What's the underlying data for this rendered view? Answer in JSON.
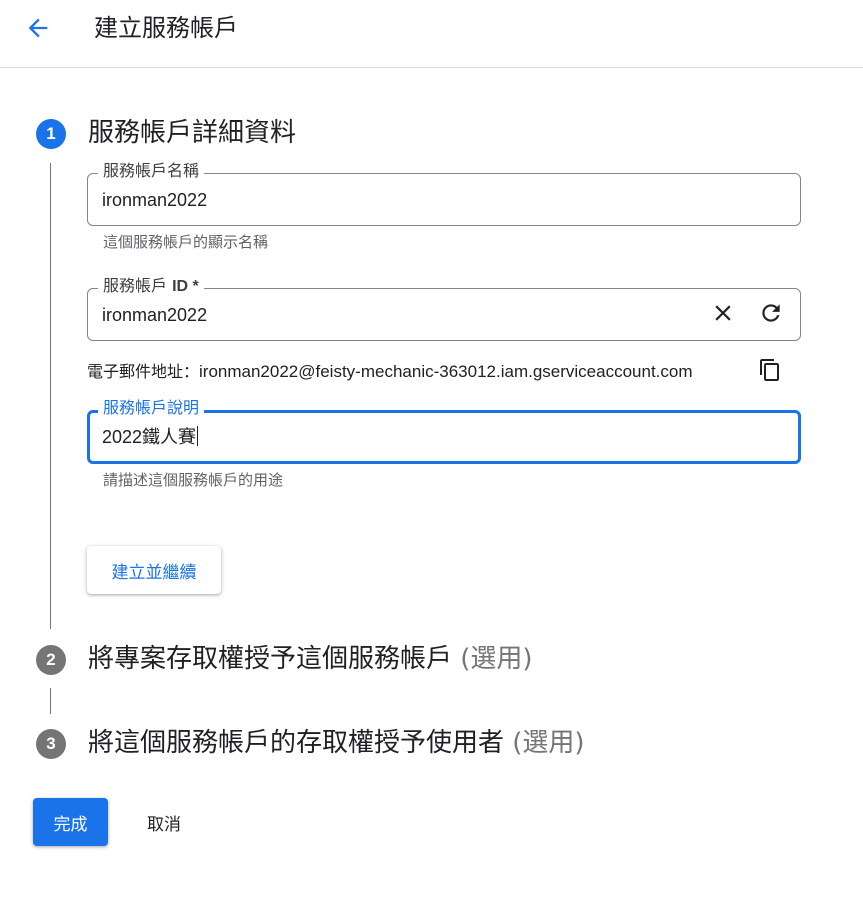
{
  "header": {
    "title": "建立服務帳戶",
    "back_icon": "arrow-back-icon"
  },
  "steps": [
    {
      "number": "1",
      "title": "服務帳戶詳細資料",
      "optional": ""
    },
    {
      "number": "2",
      "title": "將專案存取權授予這個服務帳戶",
      "optional": "(選用)"
    },
    {
      "number": "3",
      "title": "將這個服務帳戶的存取權授予使用者",
      "optional": "(選用)"
    }
  ],
  "form": {
    "name": {
      "label": "服務帳戶名稱",
      "value": "ironman2022",
      "helper": "這個服務帳戶的顯示名稱"
    },
    "id": {
      "label": "服務帳戶",
      "label_suffix": "ID *",
      "value": "ironman2022",
      "clear_icon": "close-icon",
      "refresh_icon": "refresh-icon"
    },
    "email": {
      "prefix": "電子郵件地址：",
      "address": "ironman2022@feisty-mechanic-363012.iam.gserviceaccount.com",
      "copy_icon": "copy-icon"
    },
    "description": {
      "label": "服務帳戶說明",
      "value": "2022鐵人賽",
      "helper": "請描述這個服務帳戶的用途"
    },
    "create_continue_label": "建立並繼續"
  },
  "footer": {
    "done_label": "完成",
    "cancel_label": "取消"
  },
  "colors": {
    "accent": "#1a73e8",
    "inactive_step": "#757575"
  }
}
